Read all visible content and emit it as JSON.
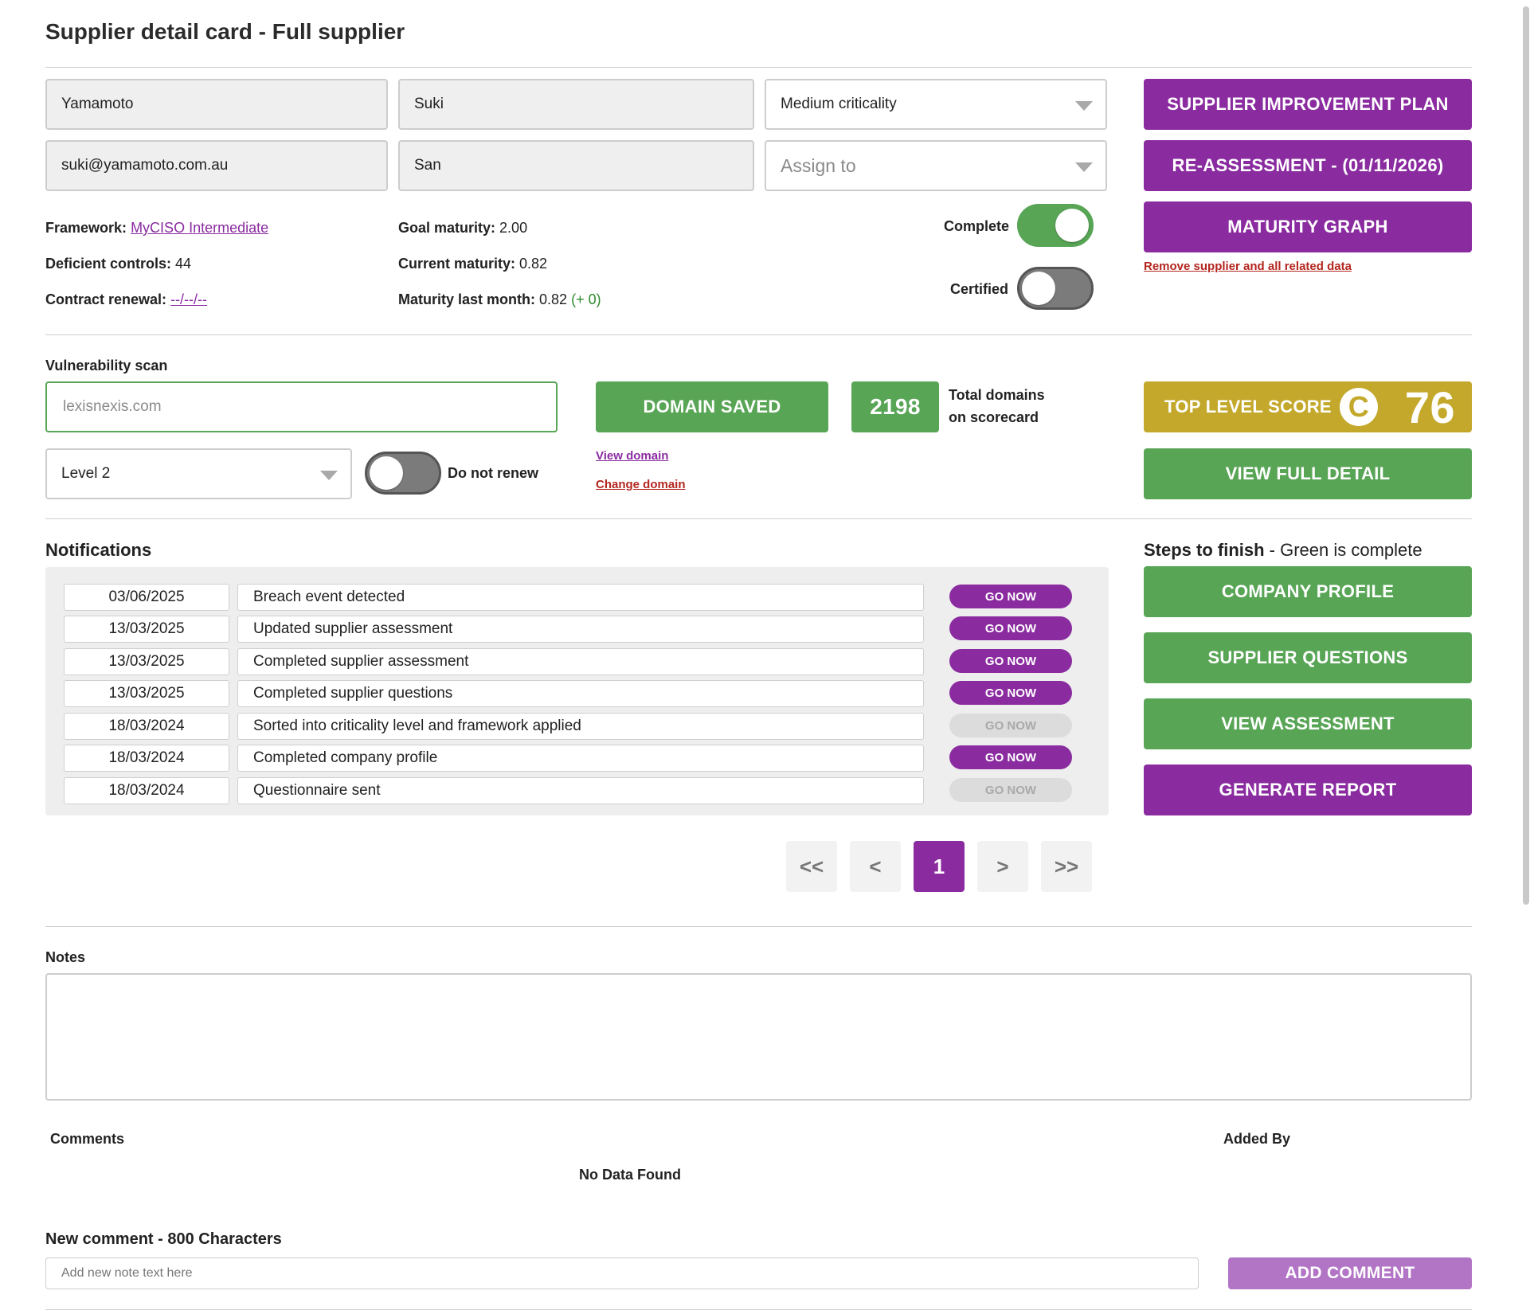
{
  "page": {
    "title": "Supplier detail card - Full supplier"
  },
  "supplier": {
    "last_name": "Yamamoto",
    "first_name": "Suki",
    "email": "suki@yamamoto.com.au",
    "preferred_name": "San",
    "criticality": "Medium criticality",
    "assign_placeholder": "Assign to"
  },
  "info": {
    "framework_label": "Framework:",
    "framework_value": "MyCISO Intermediate",
    "deficient_label": "Deficient controls:",
    "deficient_value": "44",
    "renewal_label": "Contract renewal:",
    "renewal_value": "--/--/--",
    "goal_label": "Goal maturity:",
    "goal_value": "2.00",
    "current_label": "Current maturity:",
    "current_value": "0.82",
    "last_month_label": "Maturity last month:",
    "last_month_value": "0.82",
    "last_month_delta": "(+ 0)"
  },
  "toggles": {
    "complete_label": "Complete",
    "complete_on": true,
    "certified_label": "Certified",
    "certified_on": false,
    "do_not_renew_label": "Do not renew",
    "do_not_renew_on": false
  },
  "actions": {
    "improvement_plan": "SUPPLIER IMPROVEMENT PLAN",
    "reassessment": "RE-ASSESSMENT - (01/11/2026)",
    "maturity_graph": "MATURITY GRAPH",
    "remove_supplier": "Remove supplier and all related data"
  },
  "vuln": {
    "heading": "Vulnerability scan",
    "domain_value": "lexisnexis.com",
    "domain_saved": "DOMAIN SAVED",
    "domains_count": "2198",
    "domains_label_1": "Total domains",
    "domains_label_2": "on scorecard",
    "view_domain": "View domain",
    "change_domain": "Change domain",
    "level": "Level 2",
    "top_score_label": "TOP LEVEL SCORE",
    "grade": "C",
    "score": "76",
    "view_full_detail": "VIEW FULL DETAIL"
  },
  "colors": {
    "purple": "#8a2ba0",
    "green": "#58a556",
    "gold": "#c3a82b",
    "red_link": "#b3261e",
    "delta_green": "#2e8b2e"
  },
  "notifications": {
    "heading": "Notifications",
    "go_label": "GO NOW",
    "rows": [
      {
        "date": "03/06/2025",
        "text": "Breach event detected",
        "active": true
      },
      {
        "date": "13/03/2025",
        "text": "Updated supplier assessment",
        "active": true
      },
      {
        "date": "13/03/2025",
        "text": "Completed supplier assessment",
        "active": true
      },
      {
        "date": "13/03/2025",
        "text": "Completed supplier questions",
        "active": true
      },
      {
        "date": "18/03/2024",
        "text": "Sorted into criticality level and framework applied",
        "active": false
      },
      {
        "date": "18/03/2024",
        "text": "Completed company profile",
        "active": true
      },
      {
        "date": "18/03/2024",
        "text": "Questionnaire sent",
        "active": false
      }
    ]
  },
  "pagination": {
    "first": "<<",
    "prev": "<",
    "current": "1",
    "next": ">",
    "last": ">>"
  },
  "steps": {
    "heading_bold": "Steps to finish",
    "heading_rest": " - Green is complete",
    "company_profile": "COMPANY PROFILE",
    "supplier_questions": "SUPPLIER QUESTIONS",
    "view_assessment": "VIEW ASSESSMENT",
    "generate_report": "GENERATE REPORT"
  },
  "notes": {
    "heading": "Notes",
    "comments_col": "Comments",
    "added_by_col": "Added By",
    "empty": "No Data Found",
    "new_comment_label": "New comment - 800 Characters",
    "new_comment_placeholder": "Add new note text here",
    "add_comment": "ADD COMMENT"
  }
}
